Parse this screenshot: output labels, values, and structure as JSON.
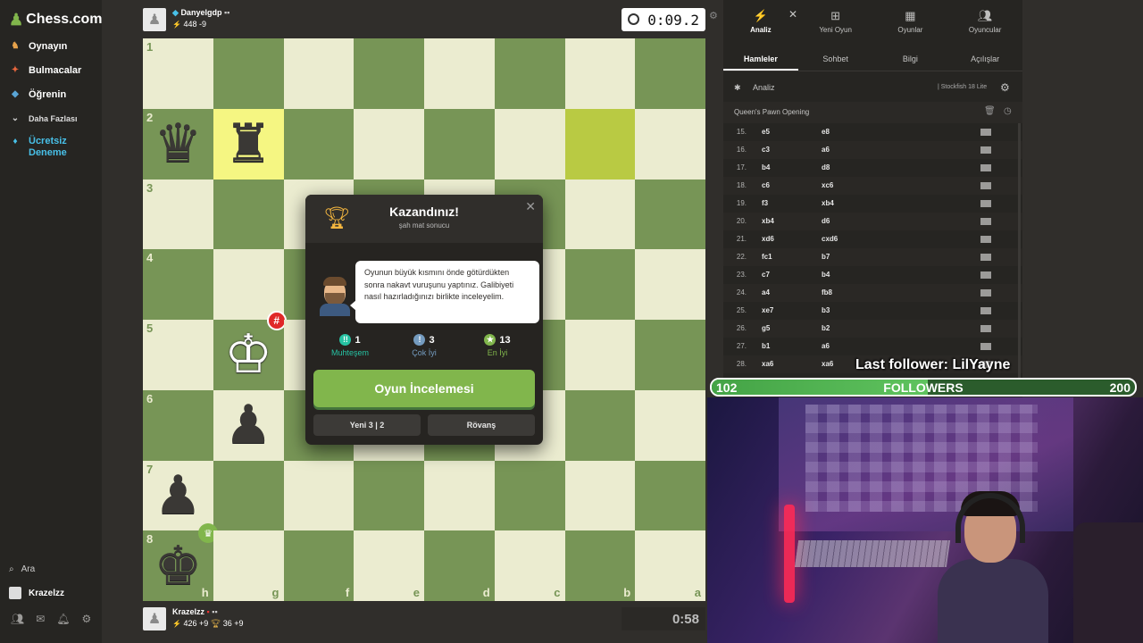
{
  "sidebar": {
    "logo": "Chess.com",
    "items": [
      {
        "label": "Oynayın",
        "icon": "play-icon",
        "color": "#e8a34b"
      },
      {
        "label": "Bulmacalar",
        "icon": "puzzle-icon",
        "color": "#e8663d"
      },
      {
        "label": "Öğrenin",
        "icon": "learn-icon",
        "color": "#5aa5d6"
      },
      {
        "label": "Daha Fazlası",
        "icon": "chevron-down-icon",
        "color": "#cccccc"
      },
      {
        "label": "Ücretsiz Deneme",
        "icon": "diamond-icon",
        "color": "#48c0e8"
      }
    ],
    "search_label": "Ara",
    "user_label": "Krazelzz"
  },
  "top_player": {
    "name": "Danyelgdp",
    "rating_line": "448 -9",
    "clock": "0:09.2"
  },
  "bottom_player": {
    "name": "Krazelzz",
    "rating_line": "426 +9",
    "trophy_line": "36 +9",
    "clock": "0:58"
  },
  "board": {
    "ranks": [
      "1",
      "2",
      "3",
      "4",
      "5",
      "6",
      "7",
      "8"
    ],
    "files": [
      "h",
      "g",
      "f",
      "e",
      "d",
      "c",
      "b",
      "a"
    ],
    "colors": {
      "light": "#ebecd0",
      "dark": "#779556",
      "highlight": "#f5f682",
      "highlight_dark": "#b9ca43"
    }
  },
  "modal": {
    "title": "Kazandınız!",
    "subtitle": "şah mat sonucu",
    "coach_text": "Oyunun büyük kısmını önde götürdükten sonra nakavt vuruşunu yaptınız. Galibiyeti nasıl hazırladığınızı birlikte inceleyelim.",
    "stats": [
      {
        "value": "1",
        "label": "Muhteşem",
        "color": "#26c2a3",
        "glyph": "!!"
      },
      {
        "value": "3",
        "label": "Çok İyi",
        "color": "#749bbf",
        "glyph": "!"
      },
      {
        "value": "13",
        "label": "En İyi",
        "color": "#81b64c",
        "glyph": "★"
      }
    ],
    "review_button": "Oyun İncelemesi",
    "new_game_button": "Yeni 3 | 2",
    "rematch_button": "Rövanş"
  },
  "right_panel": {
    "tabs": [
      "Analiz",
      "Yeni Oyun",
      "Oyunlar",
      "Oyuncular"
    ],
    "subtabs": [
      "Hamleler",
      "Sohbet",
      "Bilgi",
      "Açılışlar"
    ],
    "engine_label": "Analiz",
    "engine_name": "| Stockfish 18 Lite",
    "opening": "Queen's Pawn Opening",
    "moves": [
      {
        "num": "15.",
        "w": "e5",
        "b": "e8"
      },
      {
        "num": "16.",
        "w": "c3",
        "b": "a6"
      },
      {
        "num": "17.",
        "w": "b4",
        "b": "d8"
      },
      {
        "num": "18.",
        "w": "c6",
        "b": "xc6"
      },
      {
        "num": "19.",
        "w": "f3",
        "b": "xb4"
      },
      {
        "num": "20.",
        "w": "xb4",
        "b": "d6"
      },
      {
        "num": "21.",
        "w": "xd6",
        "b": "cxd6"
      },
      {
        "num": "22.",
        "w": "fc1",
        "b": "b7"
      },
      {
        "num": "23.",
        "w": "c7",
        "b": "b4"
      },
      {
        "num": "24.",
        "w": "a4",
        "b": "fb8"
      },
      {
        "num": "25.",
        "w": "xe7",
        "b": "b3"
      },
      {
        "num": "26.",
        "w": "g5",
        "b": "b2"
      },
      {
        "num": "27.",
        "w": "b1",
        "b": "a6"
      },
      {
        "num": "28.",
        "w": "xa6",
        "b": "xa6"
      }
    ]
  },
  "stream": {
    "last_follower": "Last follower: LilYayne",
    "followers_current": "102",
    "followers_label": "FOLLOWERS",
    "followers_goal": "200",
    "followers_progress": 0.51
  }
}
